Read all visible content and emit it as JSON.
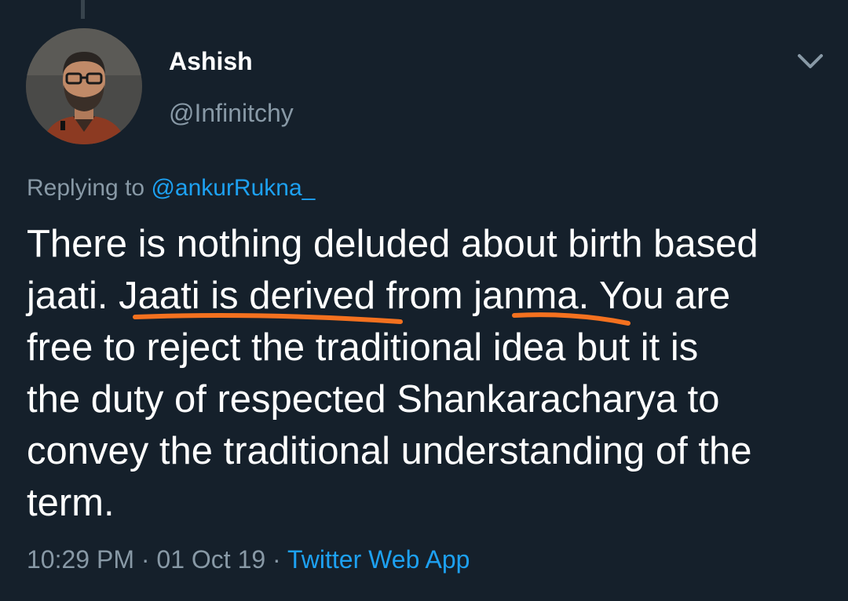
{
  "author": {
    "display_name": "Ashish",
    "handle": "@Infinitchy"
  },
  "reply": {
    "prefix": "Replying to ",
    "to_handle": "@ankurRukna_"
  },
  "tweet": {
    "text_lines": [
      "There is nothing deluded about birth based",
      "jaati. Jaati is derived from janma. You are",
      "free to reject the traditional idea but it is",
      "the duty of respected Shankaracharya to",
      "convey the traditional understanding of the",
      "term."
    ]
  },
  "meta": {
    "time": "10:29 PM",
    "separator": "·",
    "date": "01 Oct 19",
    "source": "Twitter Web App"
  },
  "icons": {
    "more": "chevron-down-icon",
    "avatar": "avatar-photo"
  },
  "colors": {
    "background": "#15202b",
    "text": "#ffffff",
    "secondary": "#8899a6",
    "link": "#1da1f2",
    "annotation": "#f4711f"
  }
}
